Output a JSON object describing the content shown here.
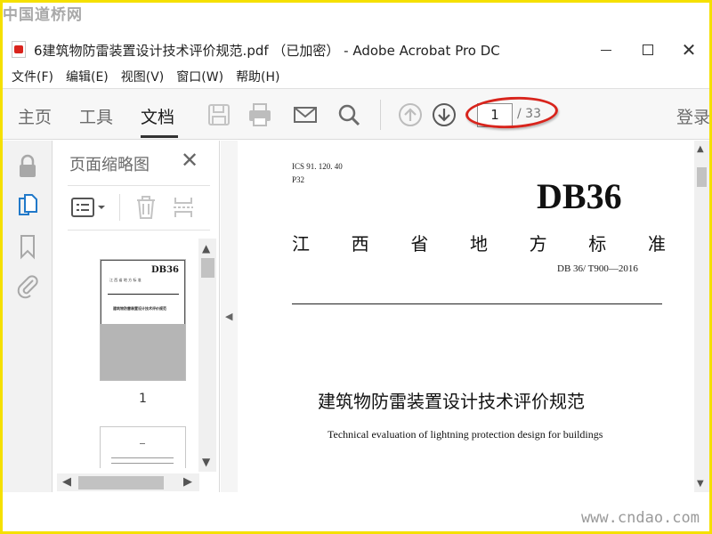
{
  "watermarks": {
    "top": "中国道桥网",
    "bottom": "www.cndao.com"
  },
  "window": {
    "title": "6建筑物防雷装置设计技术评价规范.pdf （已加密） - Adobe Acrobat Pro DC",
    "close_glyph": "✕"
  },
  "menu": [
    "文件(F)",
    "编辑(E)",
    "视图(V)",
    "窗口(W)",
    "帮助(H)"
  ],
  "toolbar": {
    "tabs": {
      "home": "主页",
      "tools": "工具",
      "document": "文档"
    },
    "page_current": "1",
    "page_total": "/ 33",
    "login": "登录",
    "icons": [
      "save-icon",
      "print-icon",
      "mail-icon",
      "search-icon",
      "prev-page-icon",
      "next-page-icon"
    ]
  },
  "sidebar": {
    "icons": [
      "lock-icon",
      "pages-icon",
      "bookmark-icon",
      "attachment-icon"
    ]
  },
  "thumbnails": {
    "title": "页面缩略图",
    "close_glyph": "✕",
    "page_label": "1",
    "thumb_text": {
      "db": "DB36",
      "province": "江 西 省 地 方 标 准",
      "title": "建筑物防雷装置设计技术评价规范"
    }
  },
  "document": {
    "ics": "ICS 91. 120. 40",
    "class_code": "P32",
    "standard_code": "DB36",
    "province_chars": [
      "江",
      "西",
      "省",
      "地",
      "方",
      "标",
      "准"
    ],
    "standard_number": "DB 36/ T900—2016",
    "title_cn": "建筑物防雷装置设计技术评价规范",
    "title_en": "Technical evaluation of lightning protection design for buildings"
  },
  "colors": {
    "highlight_ellipse": "#d8241c",
    "frame": "#f5e000",
    "toolbar_bg": "#f7f7f7"
  }
}
